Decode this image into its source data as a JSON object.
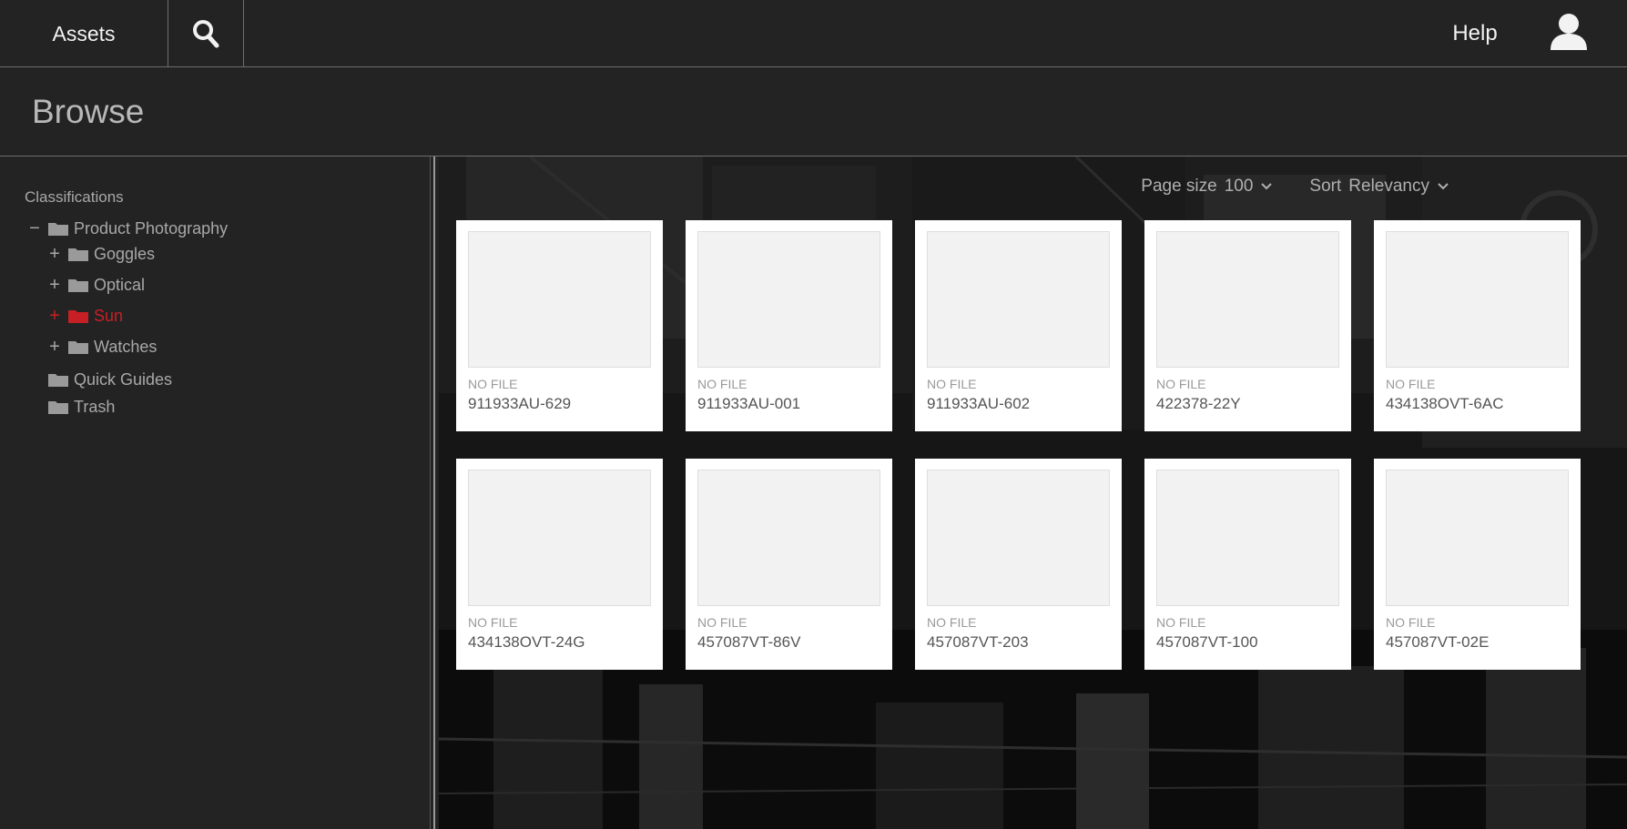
{
  "topbar": {
    "assets_label": "Assets",
    "search_icon": "search-icon",
    "help_label": "Help",
    "user_icon": "user-icon"
  },
  "page": {
    "title": "Browse"
  },
  "sidebar": {
    "heading": "Classifications",
    "tree": [
      {
        "label": "Product Photography",
        "toggle": "−",
        "level": 0,
        "active": false
      },
      {
        "label": "Goggles",
        "toggle": "+",
        "level": 1,
        "active": false
      },
      {
        "label": "Optical",
        "toggle": "+",
        "level": 1,
        "active": false
      },
      {
        "label": "Sun",
        "toggle": "+",
        "level": 1,
        "active": true
      },
      {
        "label": "Watches",
        "toggle": "+",
        "level": 1,
        "active": false
      },
      {
        "label": "Quick Guides",
        "toggle": "",
        "level": 0,
        "active": false
      },
      {
        "label": "Trash",
        "toggle": "",
        "level": 0,
        "active": false
      }
    ]
  },
  "toolbar": {
    "page_size_label": "Page size",
    "page_size_value": "100",
    "sort_label": "Sort",
    "sort_value": "Relevancy"
  },
  "cards": [
    {
      "status": "NO FILE",
      "code": "911933AU-629"
    },
    {
      "status": "NO FILE",
      "code": "911933AU-001"
    },
    {
      "status": "NO FILE",
      "code": "911933AU-602"
    },
    {
      "status": "NO FILE",
      "code": "422378-22Y"
    },
    {
      "status": "NO FILE",
      "code": "434138OVT-6AC"
    },
    {
      "status": "NO FILE",
      "code": "434138OVT-24G"
    },
    {
      "status": "NO FILE",
      "code": "457087VT-86V"
    },
    {
      "status": "NO FILE",
      "code": "457087VT-203"
    },
    {
      "status": "NO FILE",
      "code": "457087VT-100"
    },
    {
      "status": "NO FILE",
      "code": "457087VT-02E"
    }
  ],
  "colors": {
    "background": "#232323",
    "accent_active": "#c62026",
    "card": "#ffffff"
  }
}
